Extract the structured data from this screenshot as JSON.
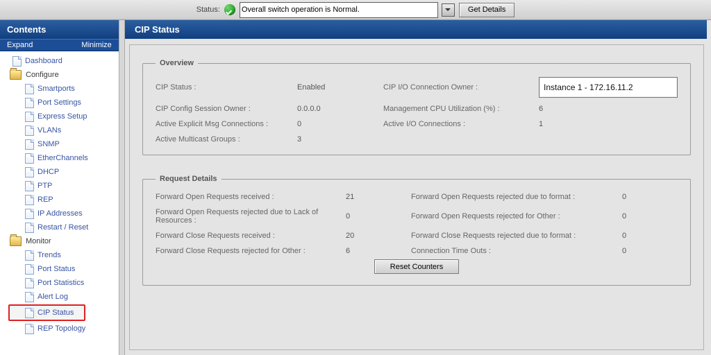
{
  "statusbar": {
    "label": "Status:",
    "message": "Overall switch operation is Normal.",
    "get_details": "Get Details"
  },
  "nav": {
    "header": "Contents",
    "expand": "Expand",
    "minimize": "Minimize",
    "dashboard": "Dashboard",
    "configure_label": "Configure",
    "configure": {
      "smartports": "Smartports",
      "port_settings": "Port Settings",
      "express_setup": "Express Setup",
      "vlans": "VLANs",
      "snmp": "SNMP",
      "etherchannels": "EtherChannels",
      "dhcp": "DHCP",
      "ptp": "PTP",
      "rep": "REP",
      "ip_addresses": "IP Addresses",
      "restart_reset": "Restart / Reset"
    },
    "monitor_label": "Monitor",
    "monitor": {
      "trends": "Trends",
      "port_status": "Port Status",
      "port_statistics": "Port Statistics",
      "alert_log": "Alert Log",
      "cip_status": "CIP Status",
      "rep_topology": "REP Topology"
    }
  },
  "panel": {
    "title": "CIP Status",
    "overview_legend": "Overview",
    "labels": {
      "cip_status": "CIP Status :",
      "cip_io_owner": "CIP I/O Connection Owner :",
      "cip_config_owner": "CIP Config Session Owner :",
      "mgmt_cpu": "Management CPU Utilization (%) :",
      "active_explicit": "Active Explicit Msg Connections :",
      "active_io": "Active I/O Connections :",
      "active_multicast": "Active Multicast Groups :"
    },
    "values": {
      "cip_status": "Enabled",
      "cip_io_owner": "Instance 1 - 172.16.11.2",
      "cip_config_owner": "0.0.0.0",
      "mgmt_cpu": "6",
      "active_explicit": "0",
      "active_io": "1",
      "active_multicast": "3"
    },
    "request_legend": "Request Details",
    "req_labels": {
      "fo_recv": "Forward Open Requests received :",
      "fo_rej_format": "Forward Open Requests rejected due to format :",
      "fo_rej_lack": "Forward Open Requests rejected due to Lack of Resources :",
      "fo_rej_other": "Forward Open Requests rejected for Other :",
      "fc_recv": "Forward Close Requests received :",
      "fc_rej_format": "Forward Close Requests rejected due to format :",
      "fc_rej_other": "Forward Close Requests rejected for Other :",
      "conn_timeouts": "Connection Time Outs :"
    },
    "req_values": {
      "fo_recv": "21",
      "fo_rej_format": "0",
      "fo_rej_lack": "0",
      "fo_rej_other": "0",
      "fc_recv": "20",
      "fc_rej_format": "0",
      "fc_rej_other": "6",
      "conn_timeouts": "0"
    },
    "reset_btn": "Reset Counters"
  }
}
